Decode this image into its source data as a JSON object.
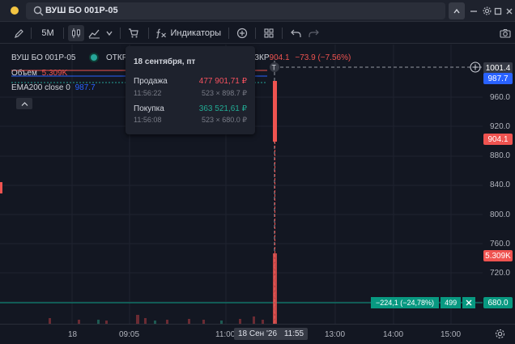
{
  "topbar": {
    "symbol": "ВУШ БО 001P-05"
  },
  "toolbar": {
    "interval": "5M",
    "indicators_label": "Индикаторы"
  },
  "legend": {
    "symbol": "ВУШ БО 001P-05",
    "open_label": "ОТКР",
    "close_label": "ЗКР",
    "close_value": "904.1",
    "change": "−73.9 (−7.56%)",
    "volume_label": "Объем",
    "volume_value": "5.309K",
    "ema_label": "EMA200 close 0",
    "ema_value": "987.7"
  },
  "tooltip": {
    "date": "18 сентября, пт",
    "sell_label": "Продажа",
    "sell_value": "477 901,71 ₽",
    "sell_time": "11:56:22",
    "sell_detail": "523 × 898.7 ₽",
    "buy_label": "Покупка",
    "buy_value": "363 521,61 ₽",
    "buy_time": "11:56:08",
    "buy_detail": "523 × 680.0 ₽"
  },
  "price_axis": {
    "ticks": [
      "960.0",
      "920.0",
      "880.0",
      "840.0",
      "800.0",
      "760.0",
      "720.0"
    ],
    "crosshair_price": "1001.4",
    "ema_tag": "987.7",
    "last_price_tag": "904.1",
    "volume_tag": "5.309K",
    "position_tag": "680.0"
  },
  "position_line": {
    "pnl": "−224,1 (−24,78%)",
    "qty": "499"
  },
  "time_axis": {
    "ticks": [
      "18",
      "09:05",
      "11:00",
      "13:00",
      "14:00",
      "15:00"
    ],
    "crosshair_date": "18 Сен '26",
    "crosshair_time": "11:55"
  },
  "colors": {
    "background": "#131722",
    "panel": "#1e222d",
    "up": "#26a69a",
    "down": "#ef5350",
    "ema": "#2962ff",
    "position": "#089981",
    "sell": "#f7525f",
    "buy": "#22ab94"
  },
  "icons": [
    "search-icon",
    "pencil-icon",
    "candles-icon",
    "chart-type-icon",
    "chevron-down-icon",
    "cart-icon",
    "fx-icon",
    "plus-circle-icon",
    "grid-icon",
    "undo-icon",
    "redo-icon",
    "camera-icon",
    "settings-icon",
    "maximize-icon",
    "close-icon"
  ]
}
